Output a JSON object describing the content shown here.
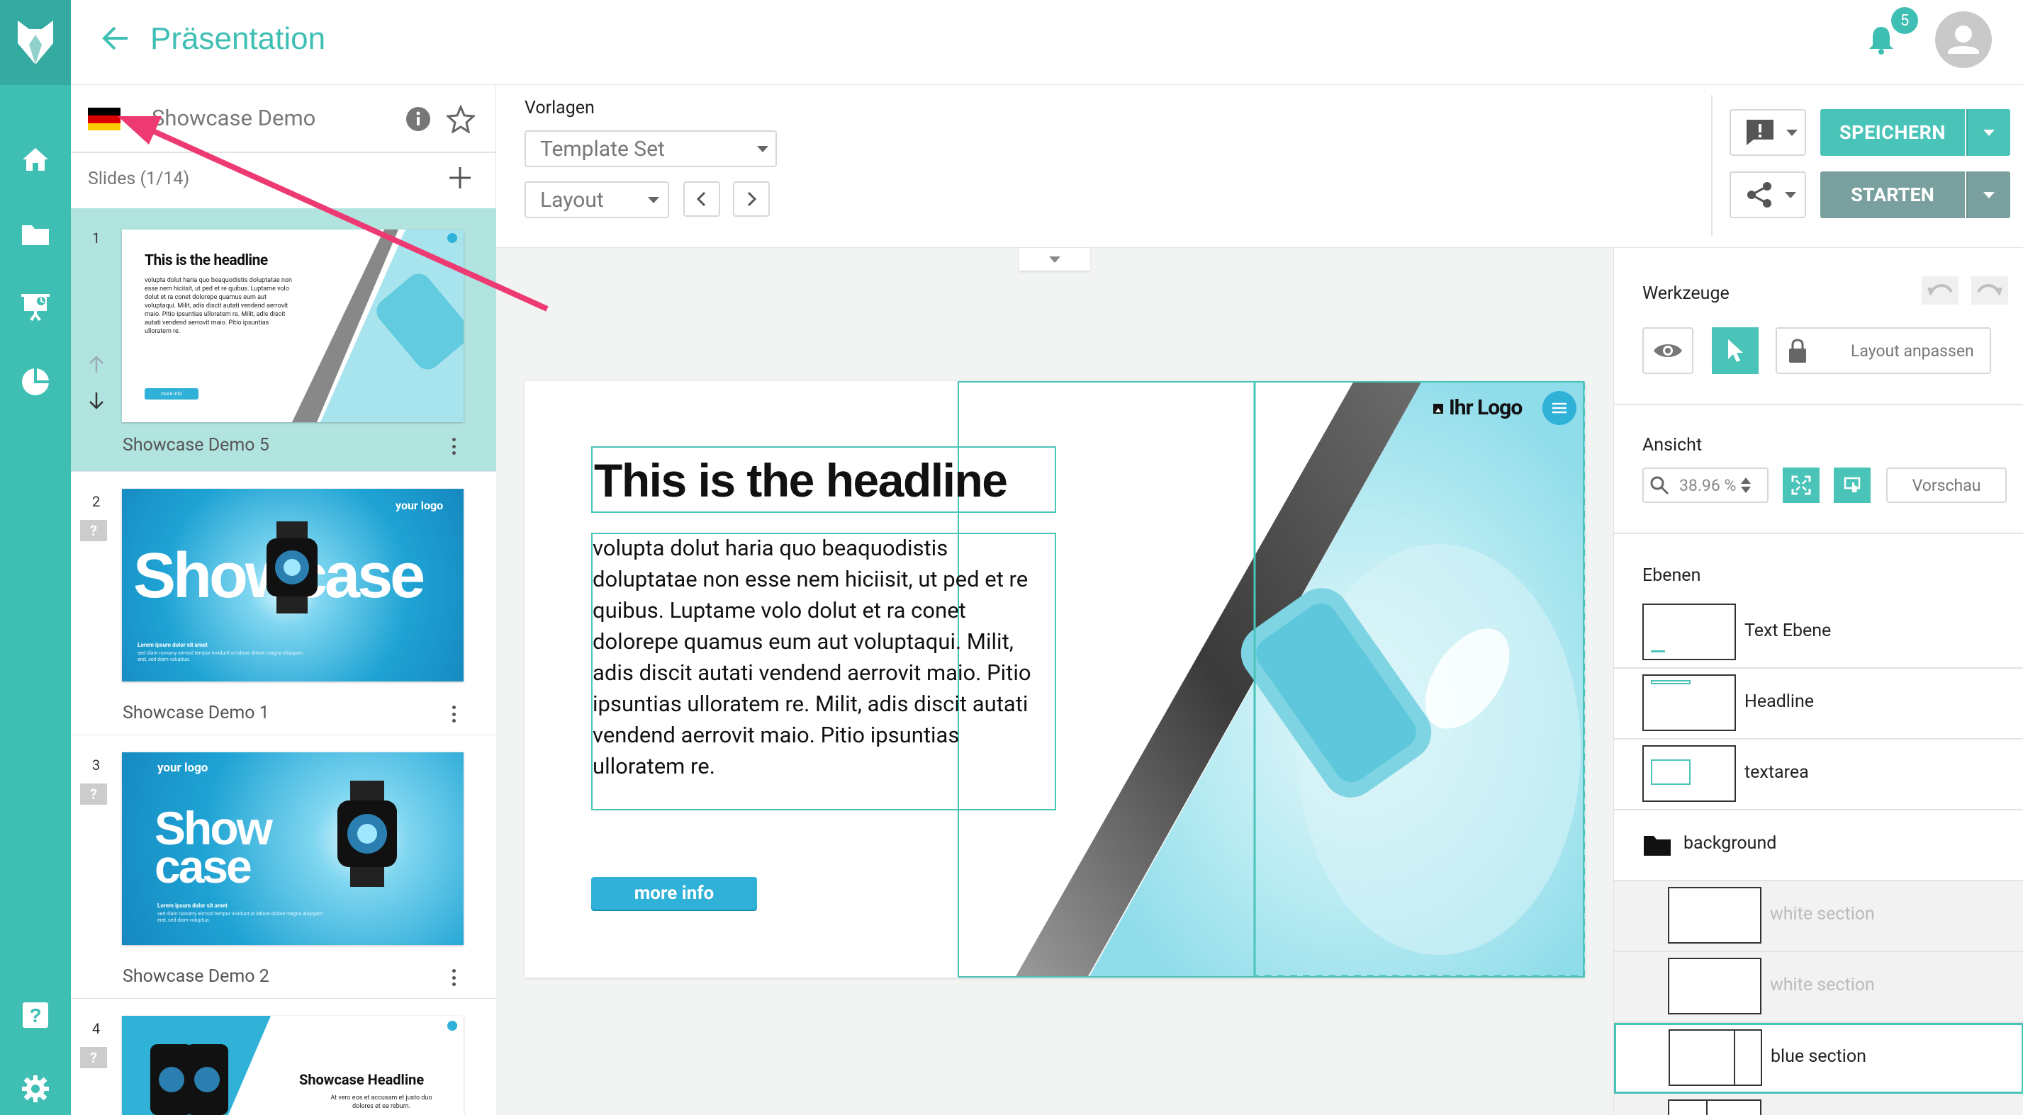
{
  "header": {
    "title": "Präsentation",
    "notification_count": "5",
    "accent_color": "#3fbfb3"
  },
  "rail": {
    "items": [
      "home-icon",
      "folder-icon",
      "presentation-icon",
      "pie-chart-icon",
      "help-icon",
      "settings-icon"
    ]
  },
  "presentation": {
    "name": "Showcase Demo",
    "language_flag": "de-flag-icon"
  },
  "slides": {
    "header": "Slides (1/14)",
    "items": [
      {
        "num": "1",
        "label": "Showcase Demo 5"
      },
      {
        "num": "2",
        "label": "Showcase Demo 1"
      },
      {
        "num": "3",
        "label": "Showcase Demo 2"
      },
      {
        "num": "4",
        "label": ""
      }
    ],
    "thumbs": {
      "t1_headline": "This is the headline",
      "t1_body": "volupta dolut haria quo beaquodistis doluptatae non esse nem hiciisit, ut ped et re quibus. Luptame volo dolut et ra conet dolorepe quamus eum aut voluptaqui. Milit, adis discit autati vendend aerrovit maio. Pitio ipsuntias ulloratem re. Milit, adis discit autati vendend aerrovit maio. Pitio ipsuntias ulloratem re.",
      "t1_btn": "more info",
      "t2_logo": "your logo",
      "t2_title": "Showcase",
      "t2_sub": "Lorem ipsum dolor sit amet",
      "t2_sub2": "sed diam nonumy eirmod tempor invidunt ut labore dolore magna aliquyam erat, sed diam voluptua.",
      "t3_logo": "your logo",
      "t3_title1": "Show",
      "t3_title2": "case",
      "t3_sub": "Lorem ipsum dolor sit amet",
      "t3_sub2": "sed diam nonumy eirmod tempor invidunt ut labore dolore magna aliquyam erat, sed diam voluptua.",
      "t4_title": "Showcase Headline",
      "t4_sub": "At vero eos et accusam et justo duo dolores et ea rebum."
    }
  },
  "toolbar": {
    "vorlagen_label": "Vorlagen",
    "template_set": "Template Set",
    "layout": "Layout",
    "save_label": "SPEICHERN",
    "start_label": "STARTEN"
  },
  "canvas": {
    "headline": "This is the headline",
    "body": "volupta dolut haria quo beaquodistis doluptatae non esse nem hiciisit, ut ped et re quibus. Luptame volo dolut et ra conet dolorepe quamus eum aut voluptaqui. Milit, adis discit autati vendend aerrovit maio. Pitio ipsuntias ulloratem re. Milit, adis discit autati vendend aerrovit maio. Pitio ipsuntias ulloratem re.",
    "button": "more info",
    "logo": "Ihr Logo"
  },
  "tools": {
    "title": "Werkzeuge",
    "layout_adjust": "Layout anpassen",
    "view_title": "Ansicht",
    "zoom": "38.96 %",
    "preview": "Vorschau"
  },
  "layers": {
    "title": "Ebenen",
    "items": [
      {
        "label": "Text Ebene"
      },
      {
        "label": "Headline"
      },
      {
        "label": "textarea"
      },
      {
        "label": "background"
      },
      {
        "label": "white section"
      },
      {
        "label": "white section"
      },
      {
        "label": "blue section"
      }
    ]
  }
}
